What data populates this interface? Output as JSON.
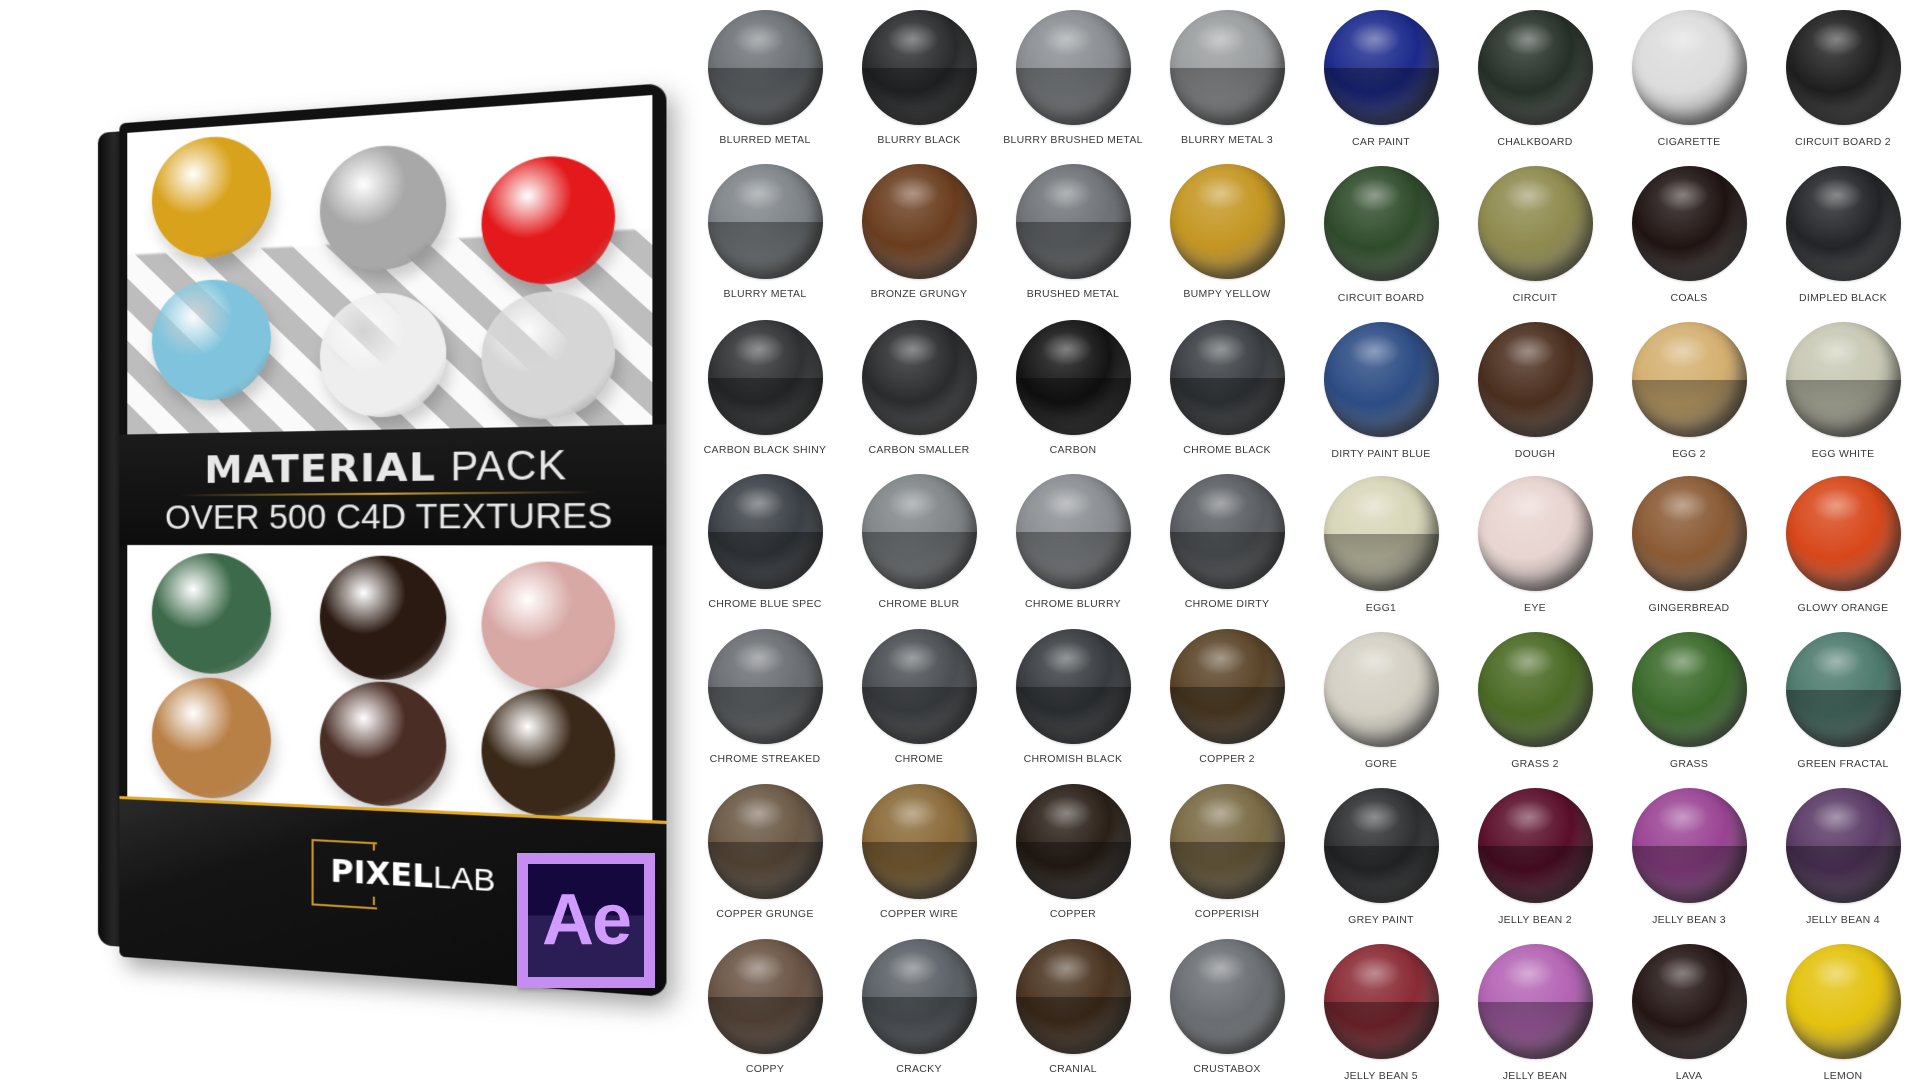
{
  "product_box": {
    "title_bold": "MATERIAL",
    "title_light": "PACK",
    "subtitle": "OVER 500 C4D TEXTURES",
    "brand_bold": "PIXEL",
    "brand_light": "LAB",
    "accent_color": "#e3a923",
    "cover_spheres_top": [
      {
        "name": "gold",
        "color": "#d9a21c"
      },
      {
        "name": "hammered-silver",
        "color": "#a8a8a8"
      },
      {
        "name": "red-dimpled",
        "color": "#e3191b"
      },
      {
        "name": "water-glass",
        "color": "#7fc4dc"
      },
      {
        "name": "soap-bubble",
        "color": "#eeeeee"
      },
      {
        "name": "clear-glass",
        "color": "#d6d6d6"
      }
    ],
    "cover_spheres_bottom": [
      {
        "name": "circuit-board",
        "color": "#3d6a4a"
      },
      {
        "name": "lava-rock",
        "color": "#2b1a12"
      },
      {
        "name": "pink-stone",
        "color": "#d8a8a4"
      },
      {
        "name": "wood",
        "color": "#b98046"
      },
      {
        "name": "brick",
        "color": "#4a2d24"
      },
      {
        "name": "dirt",
        "color": "#3a2818"
      }
    ]
  },
  "app_badge": {
    "label": "Ae",
    "icon": "after-effects-icon"
  },
  "materials": {
    "columns": 8,
    "rows": [
      [
        {
          "label": "BLURRED METAL",
          "color": "#6d7276"
        },
        {
          "label": "BLURRY BLACK",
          "color": "#2a2b2d"
        },
        {
          "label": "BLURRY BRUSHED METAL",
          "color": "#8a8e92"
        },
        {
          "label": "BLURRY METAL 3",
          "color": "#9a9d9f"
        },
        {
          "label": "CAR PAINT",
          "color": "#1b2a8c"
        },
        {
          "label": "CHALKBOARD",
          "color": "#263028"
        },
        {
          "label": "CIGARETTE",
          "color": "#dcdcdc"
        },
        {
          "label": "CIRCUIT BOARD 2",
          "color": "#1e1e1e"
        }
      ],
      [
        {
          "label": "BLURRY METAL",
          "color": "#7e8488"
        },
        {
          "label": "BRONZE GRUNGY",
          "color": "#6a3d1e"
        },
        {
          "label": "BRUSHED METAL",
          "color": "#6f7377"
        },
        {
          "label": "BUMPY YELLOW",
          "color": "#c49622"
        },
        {
          "label": "CIRCUIT BOARD",
          "color": "#2e4b2a"
        },
        {
          "label": "CIRCUIT",
          "color": "#8e8a4e"
        },
        {
          "label": "COALS",
          "color": "#1f1412"
        },
        {
          "label": "DIMPLED BLACK",
          "color": "#222428"
        }
      ],
      [
        {
          "label": "CARBON BLACK SHINY",
          "color": "#303234"
        },
        {
          "label": "CARBON SMALLER",
          "color": "#2a2b2d"
        },
        {
          "label": "CARBON",
          "color": "#141414"
        },
        {
          "label": "CHROME BLACK",
          "color": "#3a3e42"
        },
        {
          "label": "DIRTY PAINT BLUE",
          "color": "#2c4c84"
        },
        {
          "label": "DOUGH",
          "color": "#4a2e1e"
        },
        {
          "label": "EGG 2",
          "color": "#d4b070"
        },
        {
          "label": "EGG WHITE",
          "color": "#c8c8b4"
        }
      ],
      [
        {
          "label": "CHROME BLUE SPEC",
          "color": "#3a4046"
        },
        {
          "label": "CHROME BLUR",
          "color": "#808588"
        },
        {
          "label": "CHROME BLURRY",
          "color": "#8a8e92"
        },
        {
          "label": "CHROME DIRTY",
          "color": "#5a5e62"
        },
        {
          "label": "EGG1",
          "color": "#d8d6b8"
        },
        {
          "label": "EYE",
          "color": "#e8d4d0"
        },
        {
          "label": "GINGERBREAD",
          "color": "#8a5a34"
        },
        {
          "label": "GLOWY ORANGE",
          "color": "#d8471a"
        }
      ],
      [
        {
          "label": "CHROME STREAKED",
          "color": "#6a6e72"
        },
        {
          "label": "CHROME",
          "color": "#4a4e52"
        },
        {
          "label": "CHROMISH BLACK",
          "color": "#383c40"
        },
        {
          "label": "COPPER 2",
          "color": "#5a4428"
        },
        {
          "label": "GORE",
          "color": "#d4d0c4"
        },
        {
          "label": "GRASS 2",
          "color": "#4a6a24"
        },
        {
          "label": "GRASS",
          "color": "#3a6a2a"
        },
        {
          "label": "GREEN FRACTAL",
          "color": "#4e7a6e"
        }
      ],
      [
        {
          "label": "COPPER GRUNGE",
          "color": "#6a5844"
        },
        {
          "label": "COPPER WIRE",
          "color": "#8a6a38"
        },
        {
          "label": "COPPER",
          "color": "#2a2018"
        },
        {
          "label": "COPPERISH",
          "color": "#7a6a44"
        },
        {
          "label": "GREY PAINT",
          "color": "#2e2f31"
        },
        {
          "label": "JELLY BEAN 2",
          "color": "#5a0e2a"
        },
        {
          "label": "JELLY BEAN 3",
          "color": "#9a4494"
        },
        {
          "label": "JELLY BEAN 4",
          "color": "#5a3a66"
        }
      ],
      [
        {
          "label": "COPPY",
          "color": "#6a5444"
        },
        {
          "label": "CRACKY",
          "color": "#5a6066"
        },
        {
          "label": "CRANIAL",
          "color": "#4a3420"
        },
        {
          "label": "CRUSTABOX",
          "color": "#6a6e72"
        },
        {
          "label": "JELLY BEAN 5",
          "color": "#8a2a34"
        },
        {
          "label": "JELLY BEAN",
          "color": "#b464b4"
        },
        {
          "label": "LAVA",
          "color": "#241614"
        },
        {
          "label": "LEMON",
          "color": "#e4c20e"
        }
      ]
    ]
  }
}
